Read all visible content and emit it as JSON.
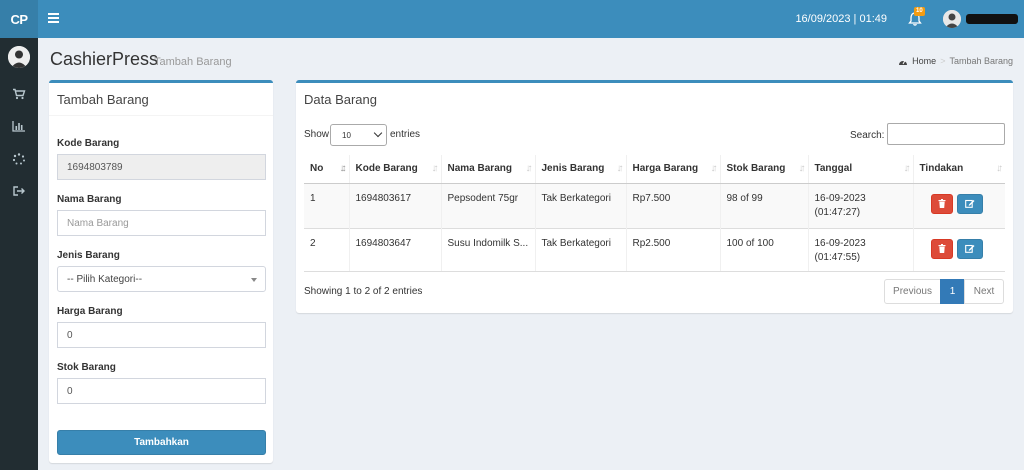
{
  "app": {
    "logo": "CP",
    "datetime": "16/09/2023 | 01:49",
    "notif_count": "10"
  },
  "header": {
    "title": "CashierPress",
    "subtitle": "Tambah Barang"
  },
  "breadcrumb": {
    "home": "Home",
    "sep": ">",
    "current": "Tambah Barang"
  },
  "form": {
    "title": "Tambah Barang",
    "kode_label": "Kode Barang",
    "kode_value": "1694803789",
    "nama_label": "Nama Barang",
    "nama_placeholder": "Nama Barang",
    "jenis_label": "Jenis Barang",
    "jenis_selected": "-- Pilih Kategori--",
    "harga_label": "Harga Barang",
    "harga_value": "0",
    "stok_label": "Stok Barang",
    "stok_value": "0",
    "submit_label": "Tambahkan"
  },
  "table": {
    "title": "Data Barang",
    "show_label": "Show",
    "length_value": "10",
    "entries_label": "entries",
    "search_label": "Search:",
    "headers": [
      "No",
      "Kode Barang",
      "Nama Barang",
      "Jenis Barang",
      "Harga Barang",
      "Stok Barang",
      "Tanggal",
      "Tindakan"
    ],
    "rows": [
      {
        "no": "1",
        "kode": "1694803617",
        "nama": "Pepsodent 75gr",
        "jenis": "Tak Berkategori",
        "harga": "Rp7.500",
        "stok": "98 of 99",
        "tanggal": "16-09-2023",
        "jam": "(01:47:27)"
      },
      {
        "no": "2",
        "kode": "1694803647",
        "nama": "Susu Indomilk S...",
        "jenis": "Tak Berkategori",
        "harga": "Rp2.500",
        "stok": "100 of 100",
        "tanggal": "16-09-2023",
        "jam": "(01:47:55)"
      }
    ],
    "info": "Showing 1 to 2 of 2 entries",
    "pager": {
      "previous": "Previous",
      "current": "1",
      "next": "Next"
    }
  },
  "colors": {
    "primary": "#3c8dbc",
    "sidebar": "#222d32",
    "danger": "#dd4b39",
    "warning": "#f39c12"
  },
  "icons": {
    "sidebar": [
      "cart-icon",
      "bar-chart-icon",
      "spinner-icon",
      "sign-out-icon"
    ],
    "header": [
      "menu-icon",
      "bell-icon"
    ],
    "actions": [
      "trash-icon",
      "edit-icon"
    ]
  }
}
